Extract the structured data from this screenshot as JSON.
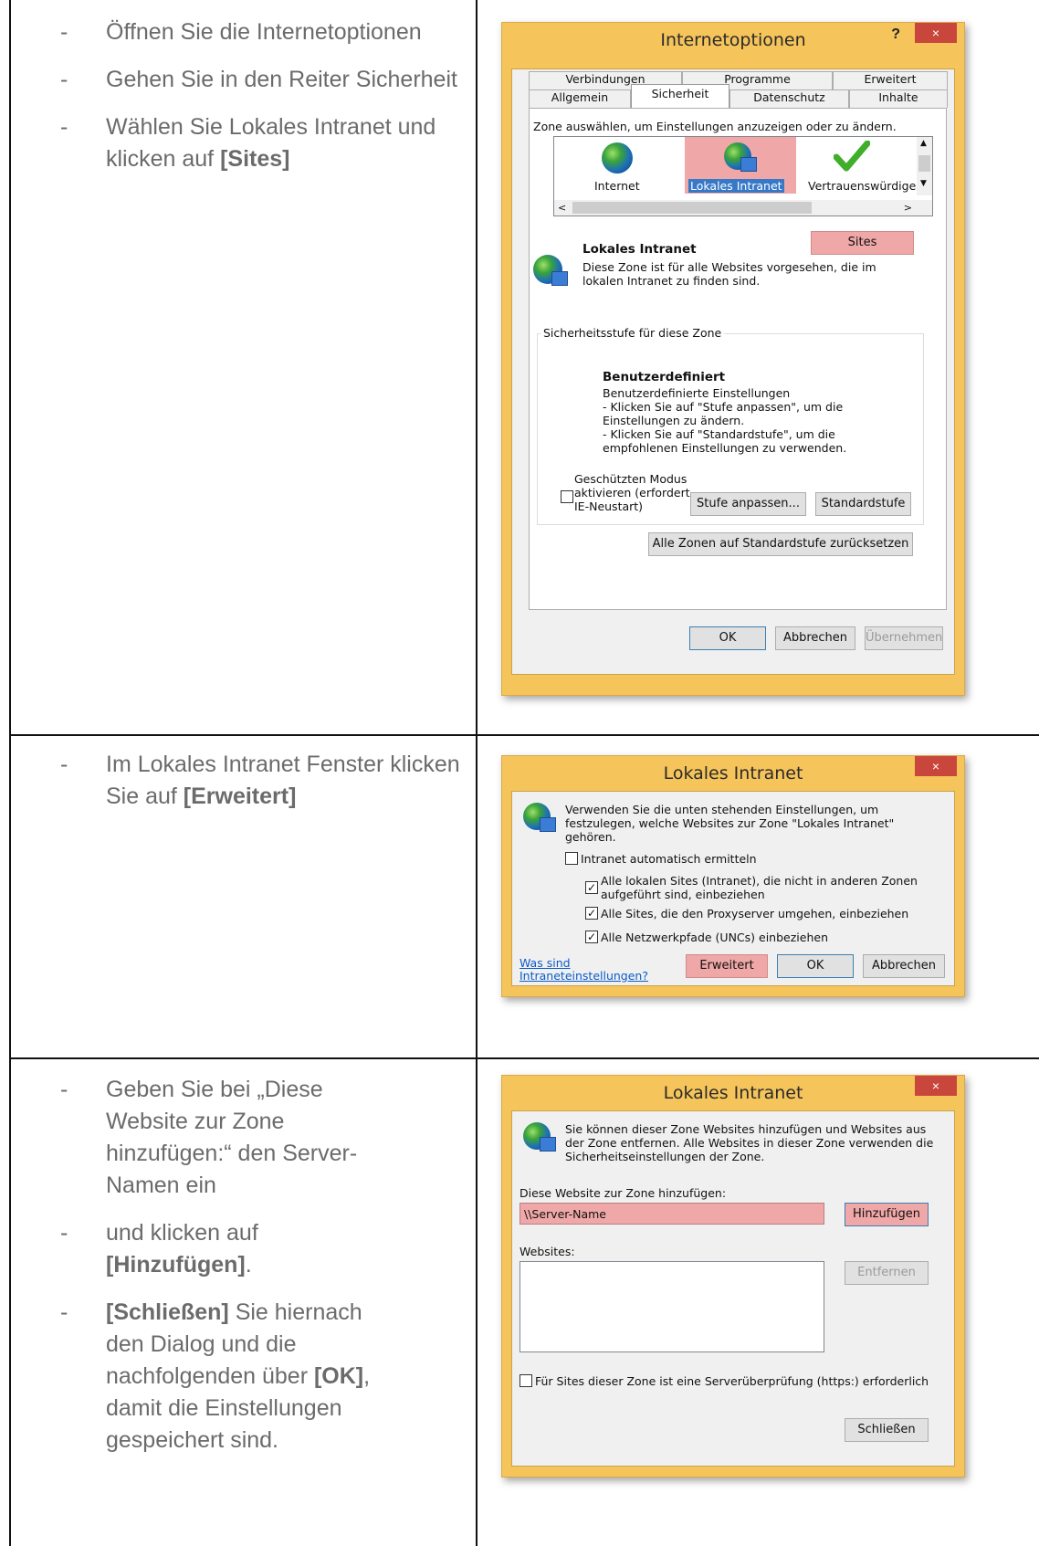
{
  "rows": [
    {
      "steps": [
        {
          "text": "Öffnen Sie die Internetoptionen"
        },
        {
          "text": "Gehen Sie in den Reiter Sicherheit"
        },
        {
          "pre": "Wählen Sie Lokales Intranet und klicken auf ",
          "bold": "[Sites]"
        }
      ]
    },
    {
      "steps": [
        {
          "pre": "Im Lokales Intranet Fenster klicken Sie auf ",
          "bold": "[Erweitert]"
        }
      ]
    },
    {
      "steps": [
        {
          "text": "Geben Sie bei „Diese Website zur Zone hinzufügen:“ den Server-Namen ein"
        },
        {
          "pre": "und klicken auf ",
          "bold": "[Hinzufügen]",
          "post": "."
        },
        {
          "bold": "[Schließen]",
          "post": " Sie hiernach den Dialog und die nachfolgenden über ",
          "bold2": "[OK]",
          "post2": ", damit die Einstellungen gespeichert sind."
        }
      ]
    }
  ],
  "dialog1": {
    "title": "Internetoptionen",
    "help": "?",
    "close": "×",
    "tabs_top": [
      "Verbindungen",
      "Programme",
      "Erweitert"
    ],
    "tabs_bottom": [
      "Allgemein",
      "Sicherheit",
      "Datenschutz",
      "Inhalte"
    ],
    "zone_prompt": "Zone auswählen, um Einstellungen anzuzeigen oder zu ändern.",
    "zones": [
      "Internet",
      "Lokales Intranet",
      "Vertrauenswürdige"
    ],
    "sites_button": "Sites",
    "zone_title": "Lokales Intranet",
    "zone_desc": "Diese Zone ist für alle Websites vorgesehen, die im lokalen Intranet zu finden sind.",
    "level_group": "Sicherheitsstufe für diese Zone",
    "level_title": "Benutzerdefiniert",
    "level_desc1": "Benutzerdefinierte Einstellungen",
    "level_desc2": "- Klicken Sie auf \"Stufe anpassen\", um die Einstellungen zu ändern.",
    "level_desc3": "- Klicken Sie auf \"Standardstufe\", um die empfohlenen Einstellungen zu verwenden.",
    "protected_mode": "Geschützten Modus aktivieren (erfordert IE-Neustart)",
    "custom_level_button": "Stufe anpassen...",
    "default_level_button": "Standardstufe",
    "reset_all_button": "Alle Zonen auf Standardstufe zurücksetzen",
    "ok": "OK",
    "cancel": "Abbrechen",
    "apply": "Übernehmen"
  },
  "dialog2": {
    "title": "Lokales Intranet",
    "close": "×",
    "intro": "Verwenden Sie die unten stehenden Einstellungen, um festzulegen, welche Websites zur Zone \"Lokales Intranet\" gehören.",
    "auto_detect": "Intranet automatisch ermitteln",
    "opt1": "Alle lokalen Sites (Intranet), die nicht in anderen Zonen aufgeführt sind, einbeziehen",
    "opt2": "Alle Sites, die den Proxyserver umgehen, einbeziehen",
    "opt3": "Alle Netzwerkpfade (UNCs) einbeziehen",
    "link1": "Was sind",
    "link2": "Intraneteinstellungen?",
    "advanced_button": "Erweitert",
    "ok": "OK",
    "cancel": "Abbrechen"
  },
  "dialog3": {
    "title": "Lokales Intranet",
    "close": "×",
    "intro": "Sie können dieser Zone Websites hinzufügen und Websites aus der Zone entfernen. Alle Websites in dieser Zone verwenden die Sicherheitseinstellungen der Zone.",
    "add_label": "Diese Website zur Zone hinzufügen:",
    "add_value": "\\\\Server-Name",
    "add_button": "Hinzufügen",
    "websites_label": "Websites:",
    "remove_button": "Entfernen",
    "https_check": "Für Sites dieser Zone ist eine Serverüberprüfung (https:) erforderlich",
    "close_button": "Schließen"
  }
}
